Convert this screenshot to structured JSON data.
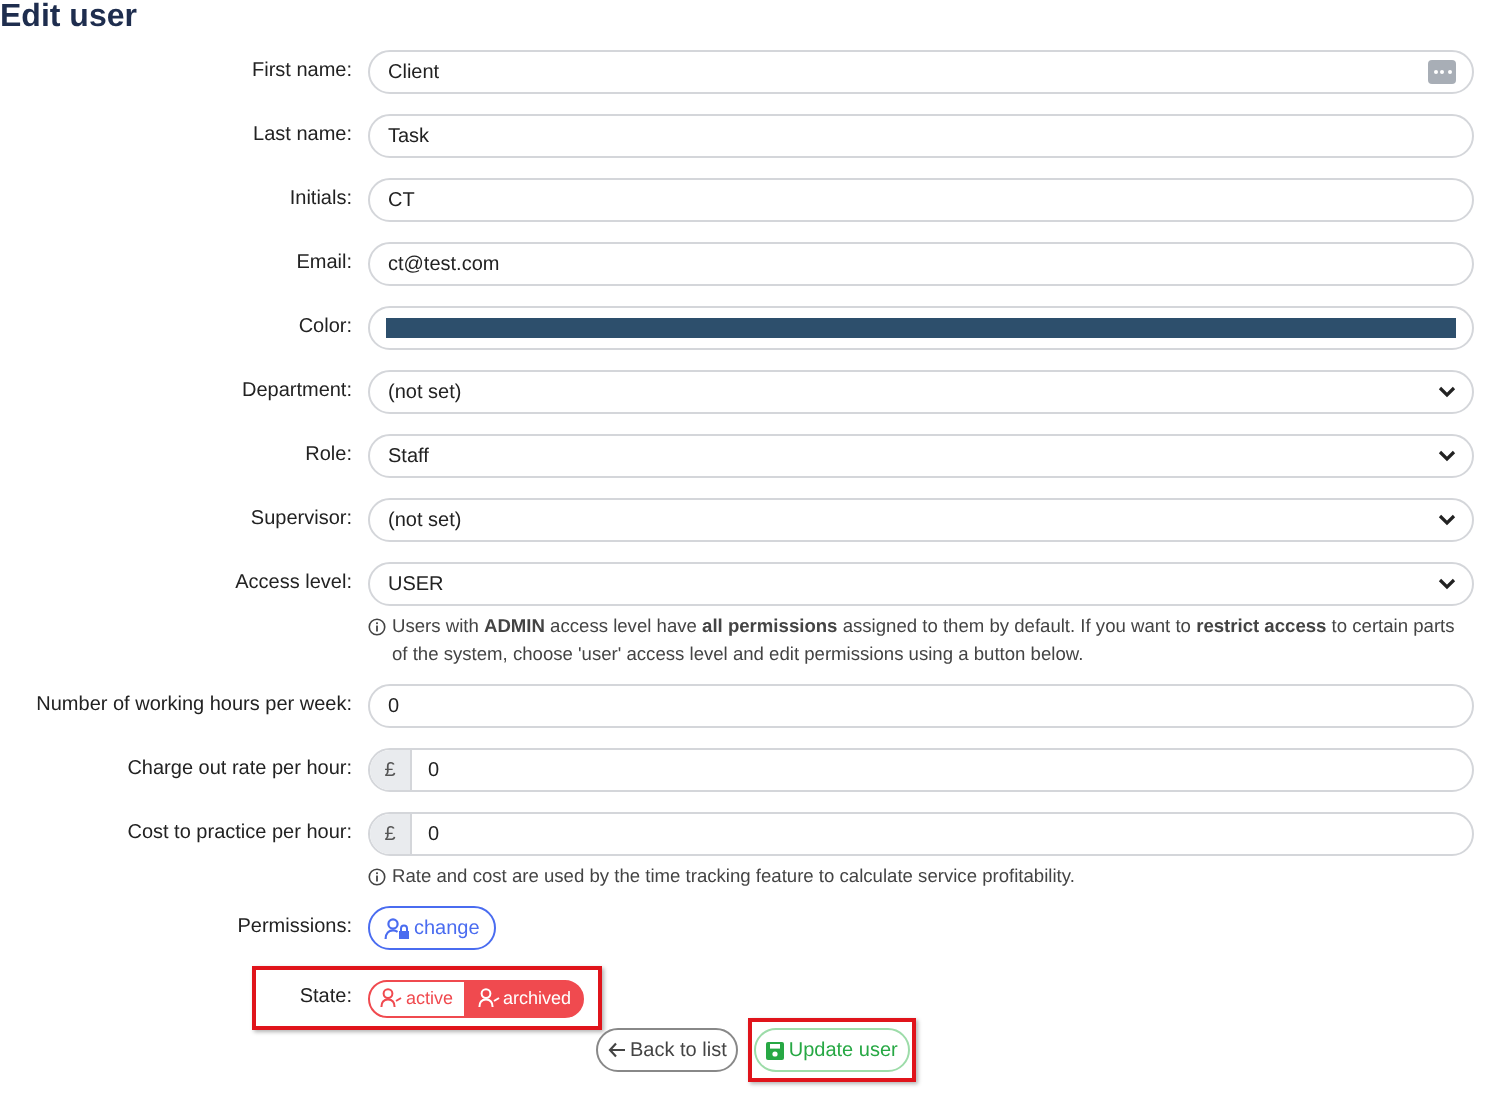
{
  "title": "Edit user",
  "fields": [
    {
      "label": "First name:",
      "kind": "text",
      "value": "Client",
      "menu_button": true
    },
    {
      "label": "Last name:",
      "kind": "text",
      "value": "Task"
    },
    {
      "label": "Initials:",
      "kind": "text",
      "value": "CT"
    },
    {
      "label": "Email:",
      "kind": "text",
      "value": "ct@test.com"
    },
    {
      "label": "Color:",
      "kind": "color",
      "color": "#2d4f6c"
    },
    {
      "label": "Department:",
      "kind": "select",
      "value": "(not set)"
    },
    {
      "label": "Role:",
      "kind": "select",
      "value": "Staff"
    },
    {
      "label": "Supervisor:",
      "kind": "select",
      "value": "(not set)"
    },
    {
      "label": "Access level:",
      "kind": "select",
      "value": "USER",
      "help": "Users with **ADMIN** access level have **all permissions** assigned to them by default. If you want to **restrict access** to certain parts of the system, choose 'user' access level and edit permissions using a button below."
    },
    {
      "label": "Number of working hours per week:",
      "kind": "text",
      "value": "0"
    },
    {
      "label": "Charge out rate per hour:",
      "kind": "money",
      "prefix": "£",
      "value": "0"
    },
    {
      "label": "Cost to practice per hour:",
      "kind": "money",
      "prefix": "£",
      "value": "0",
      "help": "Rate and cost are used by the time tracking feature to calculate service profitability."
    }
  ],
  "permissions": {
    "label": "Permissions:",
    "button": "change"
  },
  "state": {
    "label": "State:",
    "highlighted": true,
    "options": [
      {
        "label": "active",
        "selected": false
      },
      {
        "label": "archived",
        "selected": true
      }
    ]
  },
  "buttons": [
    {
      "label": "Back to list",
      "kind": "back",
      "highlighted": false
    },
    {
      "label": "Update user",
      "kind": "save",
      "highlighted": true
    }
  ]
}
